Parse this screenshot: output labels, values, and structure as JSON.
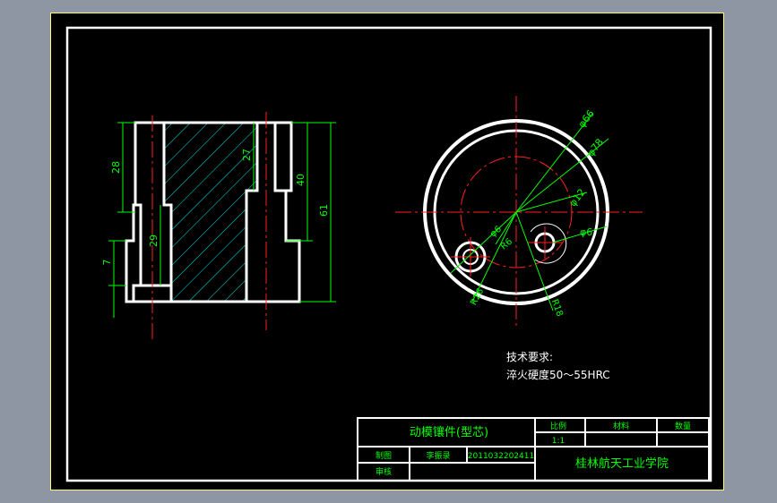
{
  "drawing": {
    "colors": {
      "outline": "#ffffff",
      "centerline": "#ff2020",
      "dimension": "#00ff00",
      "hatch": "#00e5e5",
      "label": "#00ff00",
      "background": "#000000",
      "border": "#ffff66"
    },
    "dims_left": {
      "d28": "28",
      "d27": "27",
      "d40": "40",
      "d61": "61",
      "d29": "29",
      "d7": "7"
    },
    "dims_right": {
      "phi66": "φ66",
      "phi78": "φ78",
      "phi12": "φ12",
      "phi6a": "φ6",
      "phi6b": "φ6",
      "r6": "R6",
      "r26": "R26",
      "r18": "R18"
    }
  },
  "notes": {
    "heading": "技术要求:",
    "line1": "淬火硬度50～55HRC"
  },
  "title_block": {
    "part_name": "动模镶件(型芯)",
    "scale_label": "比例",
    "scale_value": "1:1",
    "material_label": "材料",
    "quantity_label": "数量",
    "drawn_label": "制图",
    "drawn_name": "李振录",
    "student_id": "2011032202411",
    "checked_label": "审核",
    "school": "桂林航天工业学院"
  }
}
